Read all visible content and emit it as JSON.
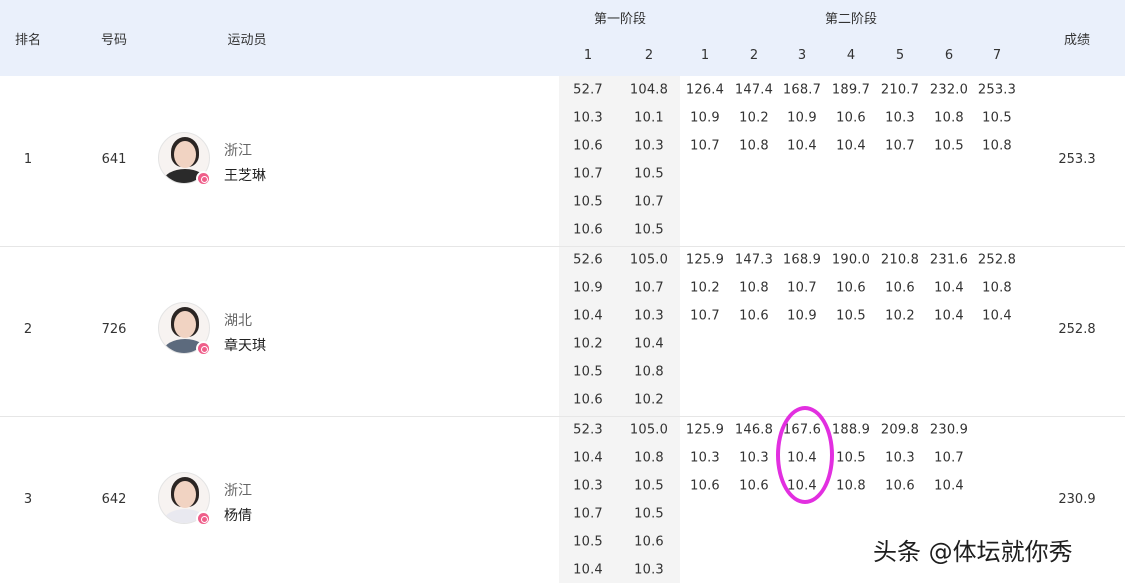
{
  "header": {
    "rank": "排名",
    "number": "号码",
    "athlete": "运动员",
    "stage1": "第一阶段",
    "stage2": "第二阶段",
    "score": "成绩",
    "stage1_cols": [
      "1",
      "2"
    ],
    "stage2_cols": [
      "1",
      "2",
      "3",
      "4",
      "5",
      "6",
      "7"
    ]
  },
  "rows": [
    {
      "rank": "1",
      "number": "641",
      "province": "浙江",
      "name": "王芝琳",
      "score": "253.3",
      "stage1": [
        [
          "52.7",
          "104.8"
        ],
        [
          "10.3",
          "10.1"
        ],
        [
          "10.6",
          "10.3"
        ],
        [
          "10.7",
          "10.5"
        ],
        [
          "10.5",
          "10.7"
        ],
        [
          "10.6",
          "10.5"
        ]
      ],
      "stage2": [
        [
          "126.4",
          "147.4",
          "168.7",
          "189.7",
          "210.7",
          "232.0",
          "253.3"
        ],
        [
          "10.9",
          "10.2",
          "10.9",
          "10.6",
          "10.3",
          "10.8",
          "10.5"
        ],
        [
          "10.7",
          "10.8",
          "10.4",
          "10.4",
          "10.7",
          "10.5",
          "10.8"
        ]
      ]
    },
    {
      "rank": "2",
      "number": "726",
      "province": "湖北",
      "name": "章天琪",
      "score": "252.8",
      "stage1": [
        [
          "52.6",
          "105.0"
        ],
        [
          "10.9",
          "10.7"
        ],
        [
          "10.4",
          "10.3"
        ],
        [
          "10.2",
          "10.4"
        ],
        [
          "10.5",
          "10.8"
        ],
        [
          "10.6",
          "10.2"
        ]
      ],
      "stage2": [
        [
          "125.9",
          "147.3",
          "168.9",
          "190.0",
          "210.8",
          "231.6",
          "252.8"
        ],
        [
          "10.2",
          "10.8",
          "10.7",
          "10.6",
          "10.6",
          "10.4",
          "10.8"
        ],
        [
          "10.7",
          "10.6",
          "10.9",
          "10.5",
          "10.2",
          "10.4",
          "10.4"
        ]
      ]
    },
    {
      "rank": "3",
      "number": "642",
      "province": "浙江",
      "name": "杨倩",
      "score": "230.9",
      "stage1": [
        [
          "52.3",
          "105.0"
        ],
        [
          "10.4",
          "10.8"
        ],
        [
          "10.3",
          "10.5"
        ],
        [
          "10.7",
          "10.5"
        ],
        [
          "10.5",
          "10.6"
        ],
        [
          "10.4",
          "10.3"
        ]
      ],
      "stage2": [
        [
          "125.9",
          "146.8",
          "167.6",
          "188.9",
          "209.8",
          "230.9"
        ],
        [
          "10.3",
          "10.3",
          "10.4",
          "10.5",
          "10.3",
          "10.7"
        ],
        [
          "10.6",
          "10.6",
          "10.4",
          "10.8",
          "10.6",
          "10.4"
        ]
      ]
    }
  ],
  "annotation": {
    "color": "#e22fe0"
  },
  "watermark": "头条 @体坛就你秀"
}
